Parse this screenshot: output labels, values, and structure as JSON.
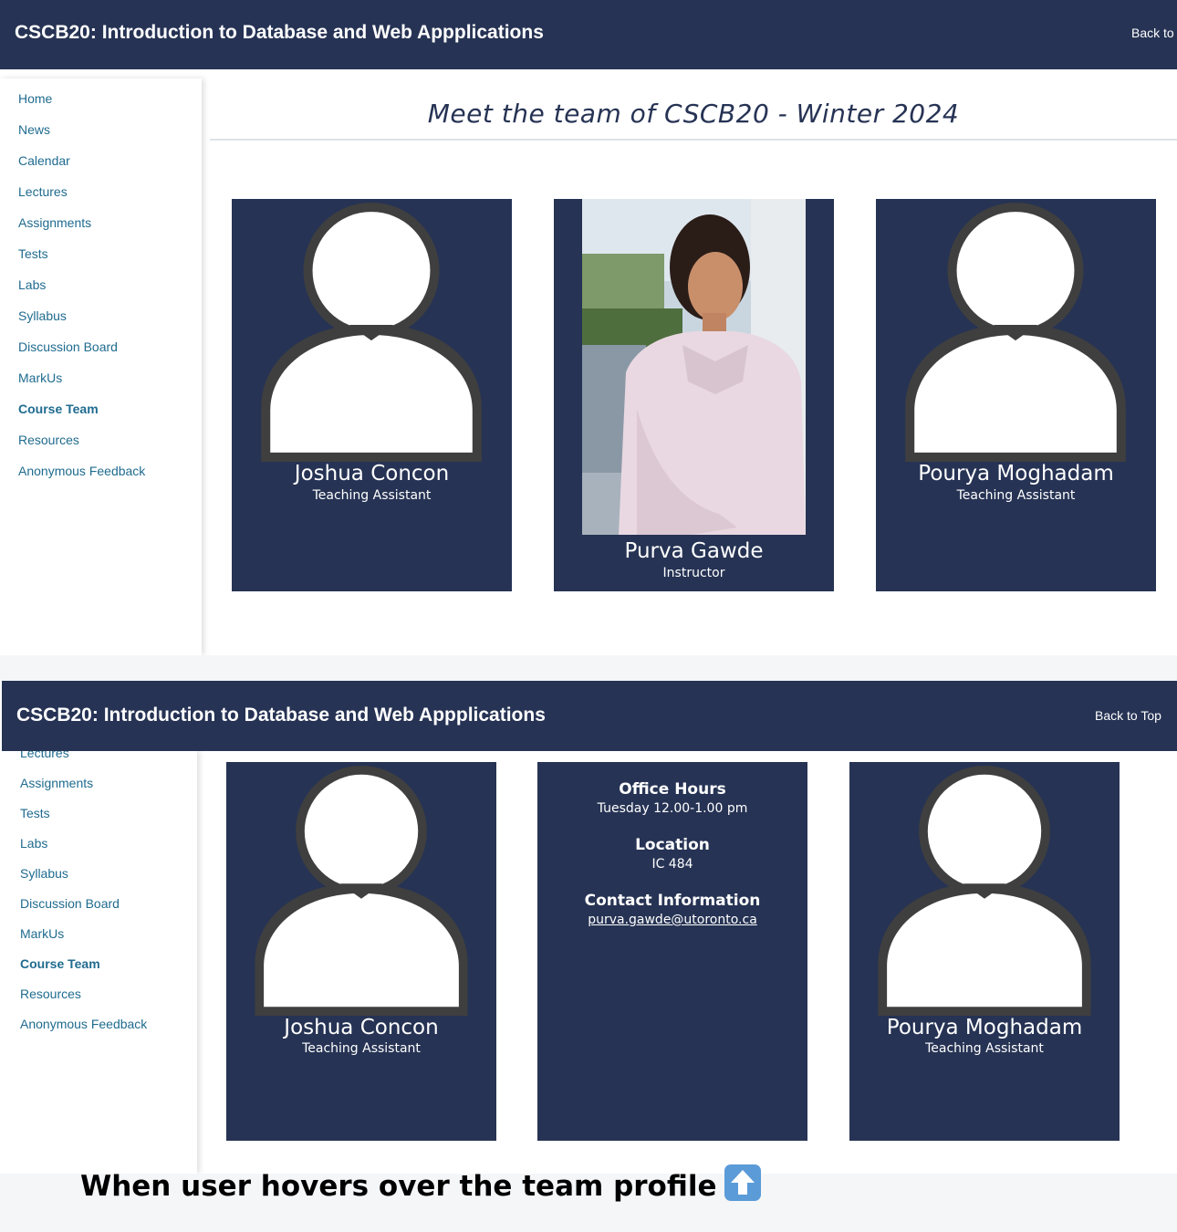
{
  "site": {
    "title": "CSCB20: Introduction to Database and Web Appplications",
    "back_to_top": "Back to Top",
    "back_to_top_truncated": "Back to"
  },
  "sidebar": {
    "items": [
      {
        "label": "Home"
      },
      {
        "label": "News"
      },
      {
        "label": "Calendar"
      },
      {
        "label": "Lectures"
      },
      {
        "label": "Assignments"
      },
      {
        "label": "Tests"
      },
      {
        "label": "Labs"
      },
      {
        "label": "Syllabus"
      },
      {
        "label": "Discussion Board"
      },
      {
        "label": "MarkUs"
      },
      {
        "label": "Course Team",
        "active": true
      },
      {
        "label": "Resources"
      },
      {
        "label": "Anonymous Feedback"
      }
    ]
  },
  "main": {
    "heading": "Meet the team of CSCB20 - Winter 2024"
  },
  "team": [
    {
      "name": "Joshua Concon",
      "role": "Teaching Assistant"
    },
    {
      "name": "Purva Gawde",
      "role": "Instructor"
    },
    {
      "name": "Pourya Moghadam",
      "role": "Teaching Assistant"
    }
  ],
  "hover_card": {
    "office_hours_title": "Office Hours",
    "office_hours_value": "Tuesday 12.00-1.00 pm",
    "location_title": "Location",
    "location_value": "IC 484",
    "contact_title": "Contact Information",
    "contact_value": "purva.gawde@utoronto.ca"
  },
  "caption": {
    "text": "When user hovers over the team profile",
    "icon": "up-arrow-icon"
  },
  "colors": {
    "navy": "#263354",
    "link": "#1f6b8f",
    "avatar_outline": "#3f3f3f"
  }
}
